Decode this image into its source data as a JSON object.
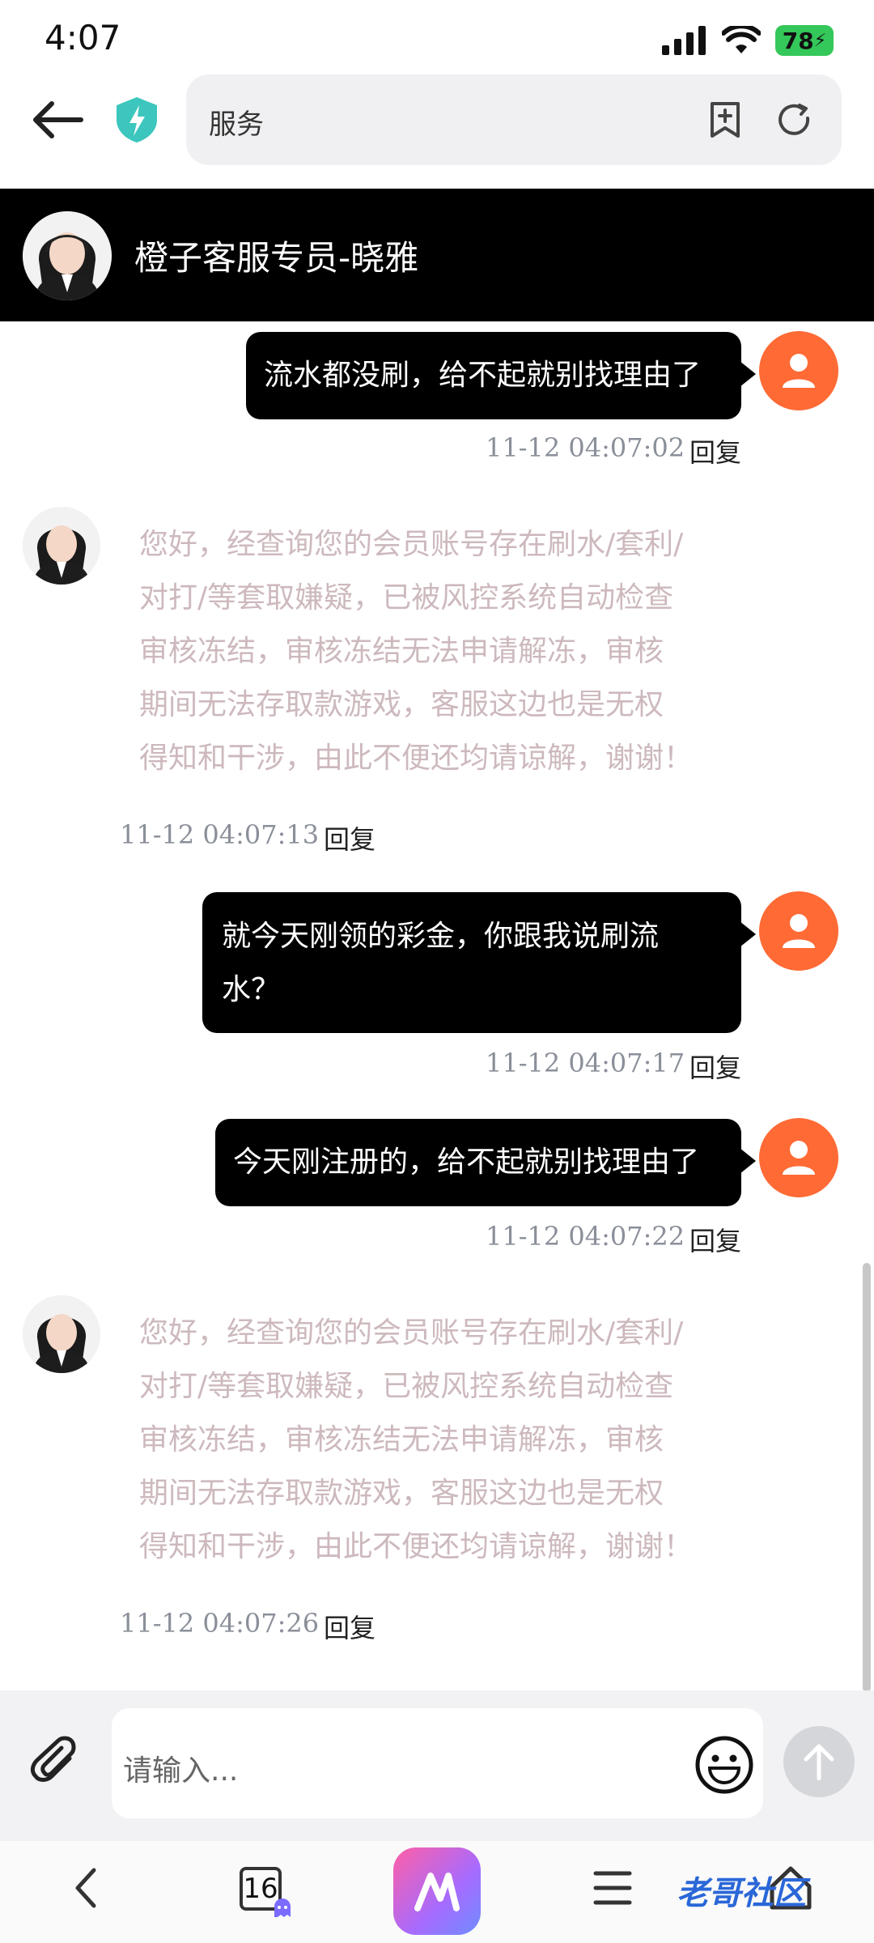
{
  "status_bar": {
    "time": "4:07",
    "battery": "78"
  },
  "browser": {
    "url_text": "服务"
  },
  "chat": {
    "title": "橙子客服专员-晓雅",
    "reply_label": "回复",
    "messages": [
      {
        "side": "user",
        "text": "流水都没刷，给不起就别找理由了",
        "time": "11-12 04:07:02"
      },
      {
        "side": "agent",
        "lines": [
          "您好，经查询您的会员账号存在刷水/套利/",
          "对打/等套取嫌疑，已被风控系统自动检查",
          "审核冻结，审核冻结无法申请解冻，审核",
          "期间无法存取款游戏，客服这边也是无权",
          "得知和干涉，由此不便还均请谅解，谢谢！"
        ],
        "time": "11-12 04:07:13"
      },
      {
        "side": "user",
        "lines": [
          "就今天刚领的彩金，你跟我说刷流",
          "水？"
        ],
        "time": "11-12 04:07:17"
      },
      {
        "side": "user",
        "text": "今天刚注册的，给不起就别找理由了",
        "time": "11-12 04:07:22"
      },
      {
        "side": "agent",
        "lines": [
          "您好，经查询您的会员账号存在刷水/套利/",
          "对打/等套取嫌疑，已被风控系统自动检查",
          "审核冻结，审核冻结无法申请解冻，审核",
          "期间无法存取款游戏，客服这边也是无权",
          "得知和干涉，由此不便还均请谅解，谢谢！"
        ],
        "time": "11-12 04:07:26"
      }
    ]
  },
  "input": {
    "placeholder": "请输入..."
  },
  "bottom_bar": {
    "tabs_count": "16",
    "watermark": "老哥社区"
  },
  "colors": {
    "user_avatar": "#ff6a35",
    "agent_text": "#cdb9bd",
    "header_bg": "#000000"
  }
}
